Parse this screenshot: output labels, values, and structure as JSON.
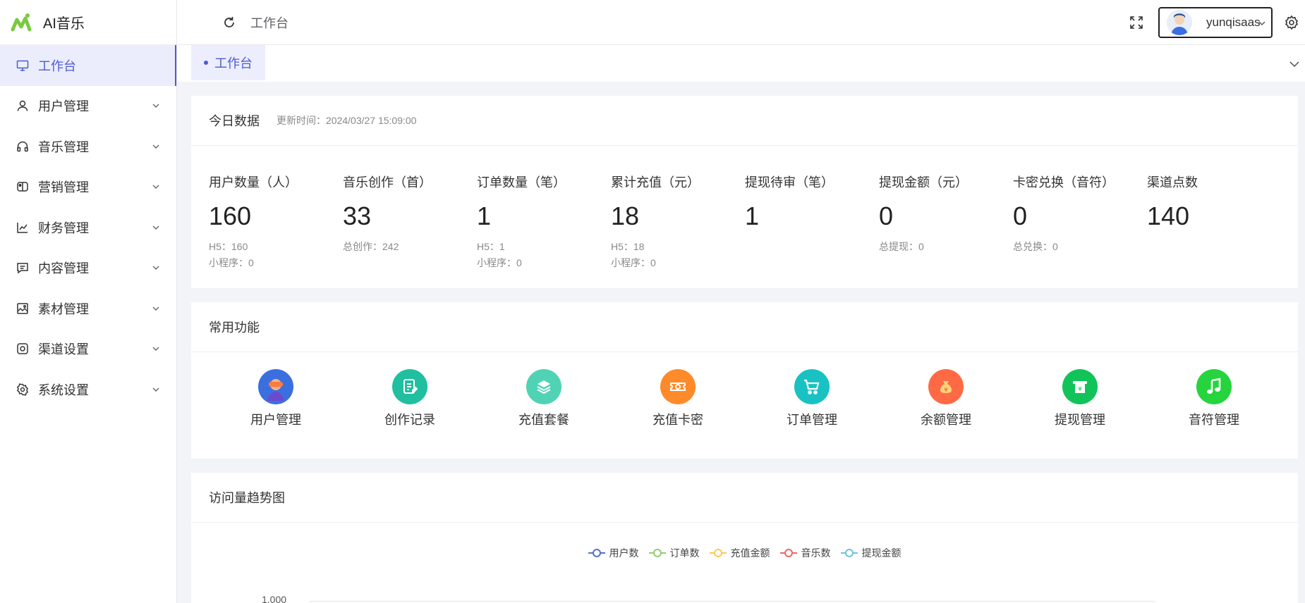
{
  "app": {
    "name": "AI音乐"
  },
  "sidebar": {
    "items": [
      {
        "label": "工作台",
        "icon": "monitor-icon"
      },
      {
        "label": "用户管理",
        "icon": "user-icon"
      },
      {
        "label": "音乐管理",
        "icon": "headphones-icon"
      },
      {
        "label": "营销管理",
        "icon": "switch-icon"
      },
      {
        "label": "财务管理",
        "icon": "chart-icon"
      },
      {
        "label": "内容管理",
        "icon": "message-icon"
      },
      {
        "label": "素材管理",
        "icon": "image-icon"
      },
      {
        "label": "渠道设置",
        "icon": "camera-icon"
      },
      {
        "label": "系统设置",
        "icon": "gear-icon"
      }
    ]
  },
  "header": {
    "breadcrumb": "工作台",
    "username": "yunqisaas"
  },
  "tabs": [
    {
      "label": "工作台"
    }
  ],
  "today": {
    "title": "今日数据",
    "update_time": "更新时间：2024/03/27 15:09:00",
    "stats": [
      {
        "label": "用户数量（人）",
        "value": "160",
        "sub1": "H5：160",
        "sub2": "小程序：0"
      },
      {
        "label": "音乐创作（首）",
        "value": "33",
        "sub1": "总创作：242",
        "sub2": ""
      },
      {
        "label": "订单数量（笔）",
        "value": "1",
        "sub1": "H5：1",
        "sub2": "小程序：0"
      },
      {
        "label": "累计充值（元）",
        "value": "18",
        "sub1": "H5：18",
        "sub2": "小程序：0"
      },
      {
        "label": "提现待审（笔）",
        "value": "1",
        "sub1": "",
        "sub2": ""
      },
      {
        "label": "提现金额（元）",
        "value": "0",
        "sub1": "总提现：0",
        "sub2": ""
      },
      {
        "label": "卡密兑换（音符）",
        "value": "0",
        "sub1": "总兑换：0",
        "sub2": ""
      },
      {
        "label": "渠道点数",
        "value": "140",
        "sub1": "",
        "sub2": ""
      }
    ]
  },
  "functions": {
    "title": "常用功能",
    "items": [
      {
        "label": "用户管理",
        "icon": "vr-user-icon",
        "color": "#3b6fe0"
      },
      {
        "label": "创作记录",
        "icon": "document-icon",
        "color": "#1fbf9f"
      },
      {
        "label": "充值套餐",
        "icon": "layers-icon",
        "color": "#4fd3b4"
      },
      {
        "label": "充值卡密",
        "icon": "ticket-icon",
        "color": "#ff8a2a"
      },
      {
        "label": "订单管理",
        "icon": "cart-icon",
        "color": "#19c2c2"
      },
      {
        "label": "余额管理",
        "icon": "money-bag-icon",
        "color": "#ff6a45"
      },
      {
        "label": "提现管理",
        "icon": "withdraw-icon",
        "color": "#12c35a"
      },
      {
        "label": "音符管理",
        "icon": "music-note-icon",
        "color": "#26d43e"
      }
    ]
  },
  "trend": {
    "title": "访问量趋势图",
    "legend": [
      {
        "name": "用户数",
        "color": "#5470c6"
      },
      {
        "name": "订单数",
        "color": "#91cc75"
      },
      {
        "name": "充值金额",
        "color": "#fac858"
      },
      {
        "name": "音乐数",
        "color": "#ee6666"
      },
      {
        "name": "提现金额",
        "color": "#73c0de"
      }
    ],
    "y_tick": "1,000"
  }
}
